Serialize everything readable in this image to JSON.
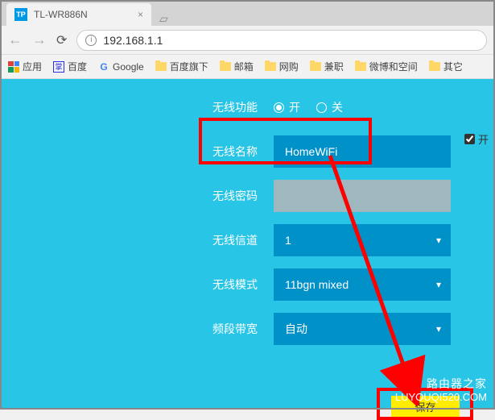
{
  "browser": {
    "tab_title": "TL-WR886N",
    "tab_favicon": "TP",
    "url": "192.168.1.1",
    "bookmarks_label": "应用",
    "bookmarks": [
      "百度",
      "Google",
      "百度旗下",
      "邮箱",
      "网购",
      "兼职",
      "微博和空间",
      "其它"
    ]
  },
  "form": {
    "wireless_func_label": "无线功能",
    "wireless_on": "开",
    "wireless_off": "关",
    "ssid_label": "无线名称",
    "ssid_value": "HomeWiFi",
    "password_label": "无线密码",
    "channel_label": "无线信道",
    "channel_value": "1",
    "mode_label": "无线模式",
    "mode_value": "11bgn mixed",
    "bandwidth_label": "频段带宽",
    "bandwidth_value": "自动",
    "side_check_label": "开",
    "save_label": "保存"
  },
  "watermark": {
    "zh": "路由器之家",
    "en": "LUYOUQI520.COM"
  }
}
